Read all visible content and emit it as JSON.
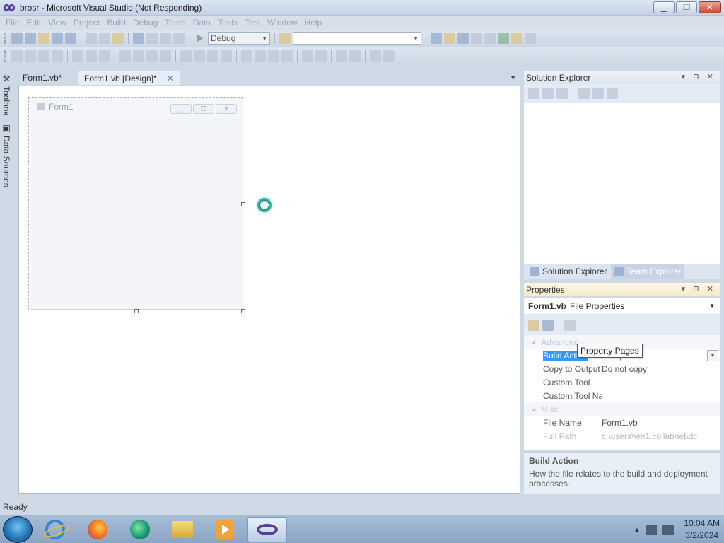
{
  "window": {
    "title": "brosr - Microsoft Visual Studio (Not Responding)",
    "minimize_label": "▁",
    "restore_label": "❐",
    "close_label": "✕"
  },
  "menu": [
    "File",
    "Edit",
    "View",
    "Project",
    "Build",
    "Debug",
    "Team",
    "Data",
    "Tools",
    "Test",
    "Window",
    "Help"
  ],
  "toolbar": {
    "config_combo": "Debug",
    "search_combo": ""
  },
  "side_tabs": [
    "Toolbox",
    "Data Sources"
  ],
  "doc_tabs": [
    {
      "label": "Form1.vb*"
    },
    {
      "label": "Form1.vb [Design]*",
      "close": "✕"
    }
  ],
  "designer": {
    "form_title": "Form1",
    "form_buttons": [
      "▁",
      "❐",
      "✕"
    ]
  },
  "solution_explorer": {
    "title": "Solution Explorer",
    "buttons": "▾ ⊓ ✕",
    "tabs": [
      "Solution Explorer",
      "Team Explorer"
    ]
  },
  "properties": {
    "title": "Properties",
    "buttons": "▾ ⊓ ✕",
    "object_name": "Form1.vb",
    "object_type": "File Properties",
    "tooltip": "Property Pages",
    "categories": [
      {
        "name": "Advanced",
        "rows": [
          {
            "name": "Build Action",
            "value": "Compile"
          },
          {
            "name": "Copy to Output Directory",
            "value": "Do not copy"
          },
          {
            "name": "Custom Tool",
            "value": ""
          },
          {
            "name": "Custom Tool Namespace",
            "value": ""
          }
        ]
      },
      {
        "name": "Misc",
        "rows": [
          {
            "name": "File Name",
            "value": "Form1.vb"
          },
          {
            "name": "Full Path",
            "value": "c:\\users\\vm1.collabnet\\dc"
          }
        ]
      }
    ],
    "description_title": "Build Action",
    "description_text": "How the file relates to the build and deployment processes."
  },
  "status": "Ready",
  "taskbar": {
    "time": "10:04 AM",
    "date": "3/2/2024"
  }
}
